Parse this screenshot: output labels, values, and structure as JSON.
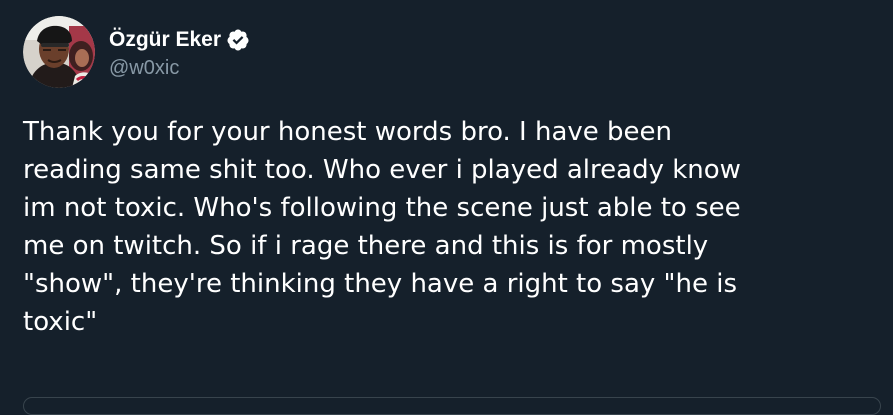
{
  "author": {
    "display_name": "Özgür Eker",
    "handle": "@w0xic",
    "verified": true,
    "avatar_icon": "user-avatar-photo"
  },
  "tweet": {
    "text": "Thank you for your honest words bro. I have been\nreading same shit too. Who ever i played already know\nim not toxic. Who's following the scene just able to see\nme on twitch. So if i rage there and this is for mostly\n\"show\", they're thinking they have a right to say \"he is\ntoxic\""
  },
  "colors": {
    "background": "#15202b",
    "text": "#ffffff",
    "secondary_text": "#8899a6",
    "border": "#38444d"
  }
}
